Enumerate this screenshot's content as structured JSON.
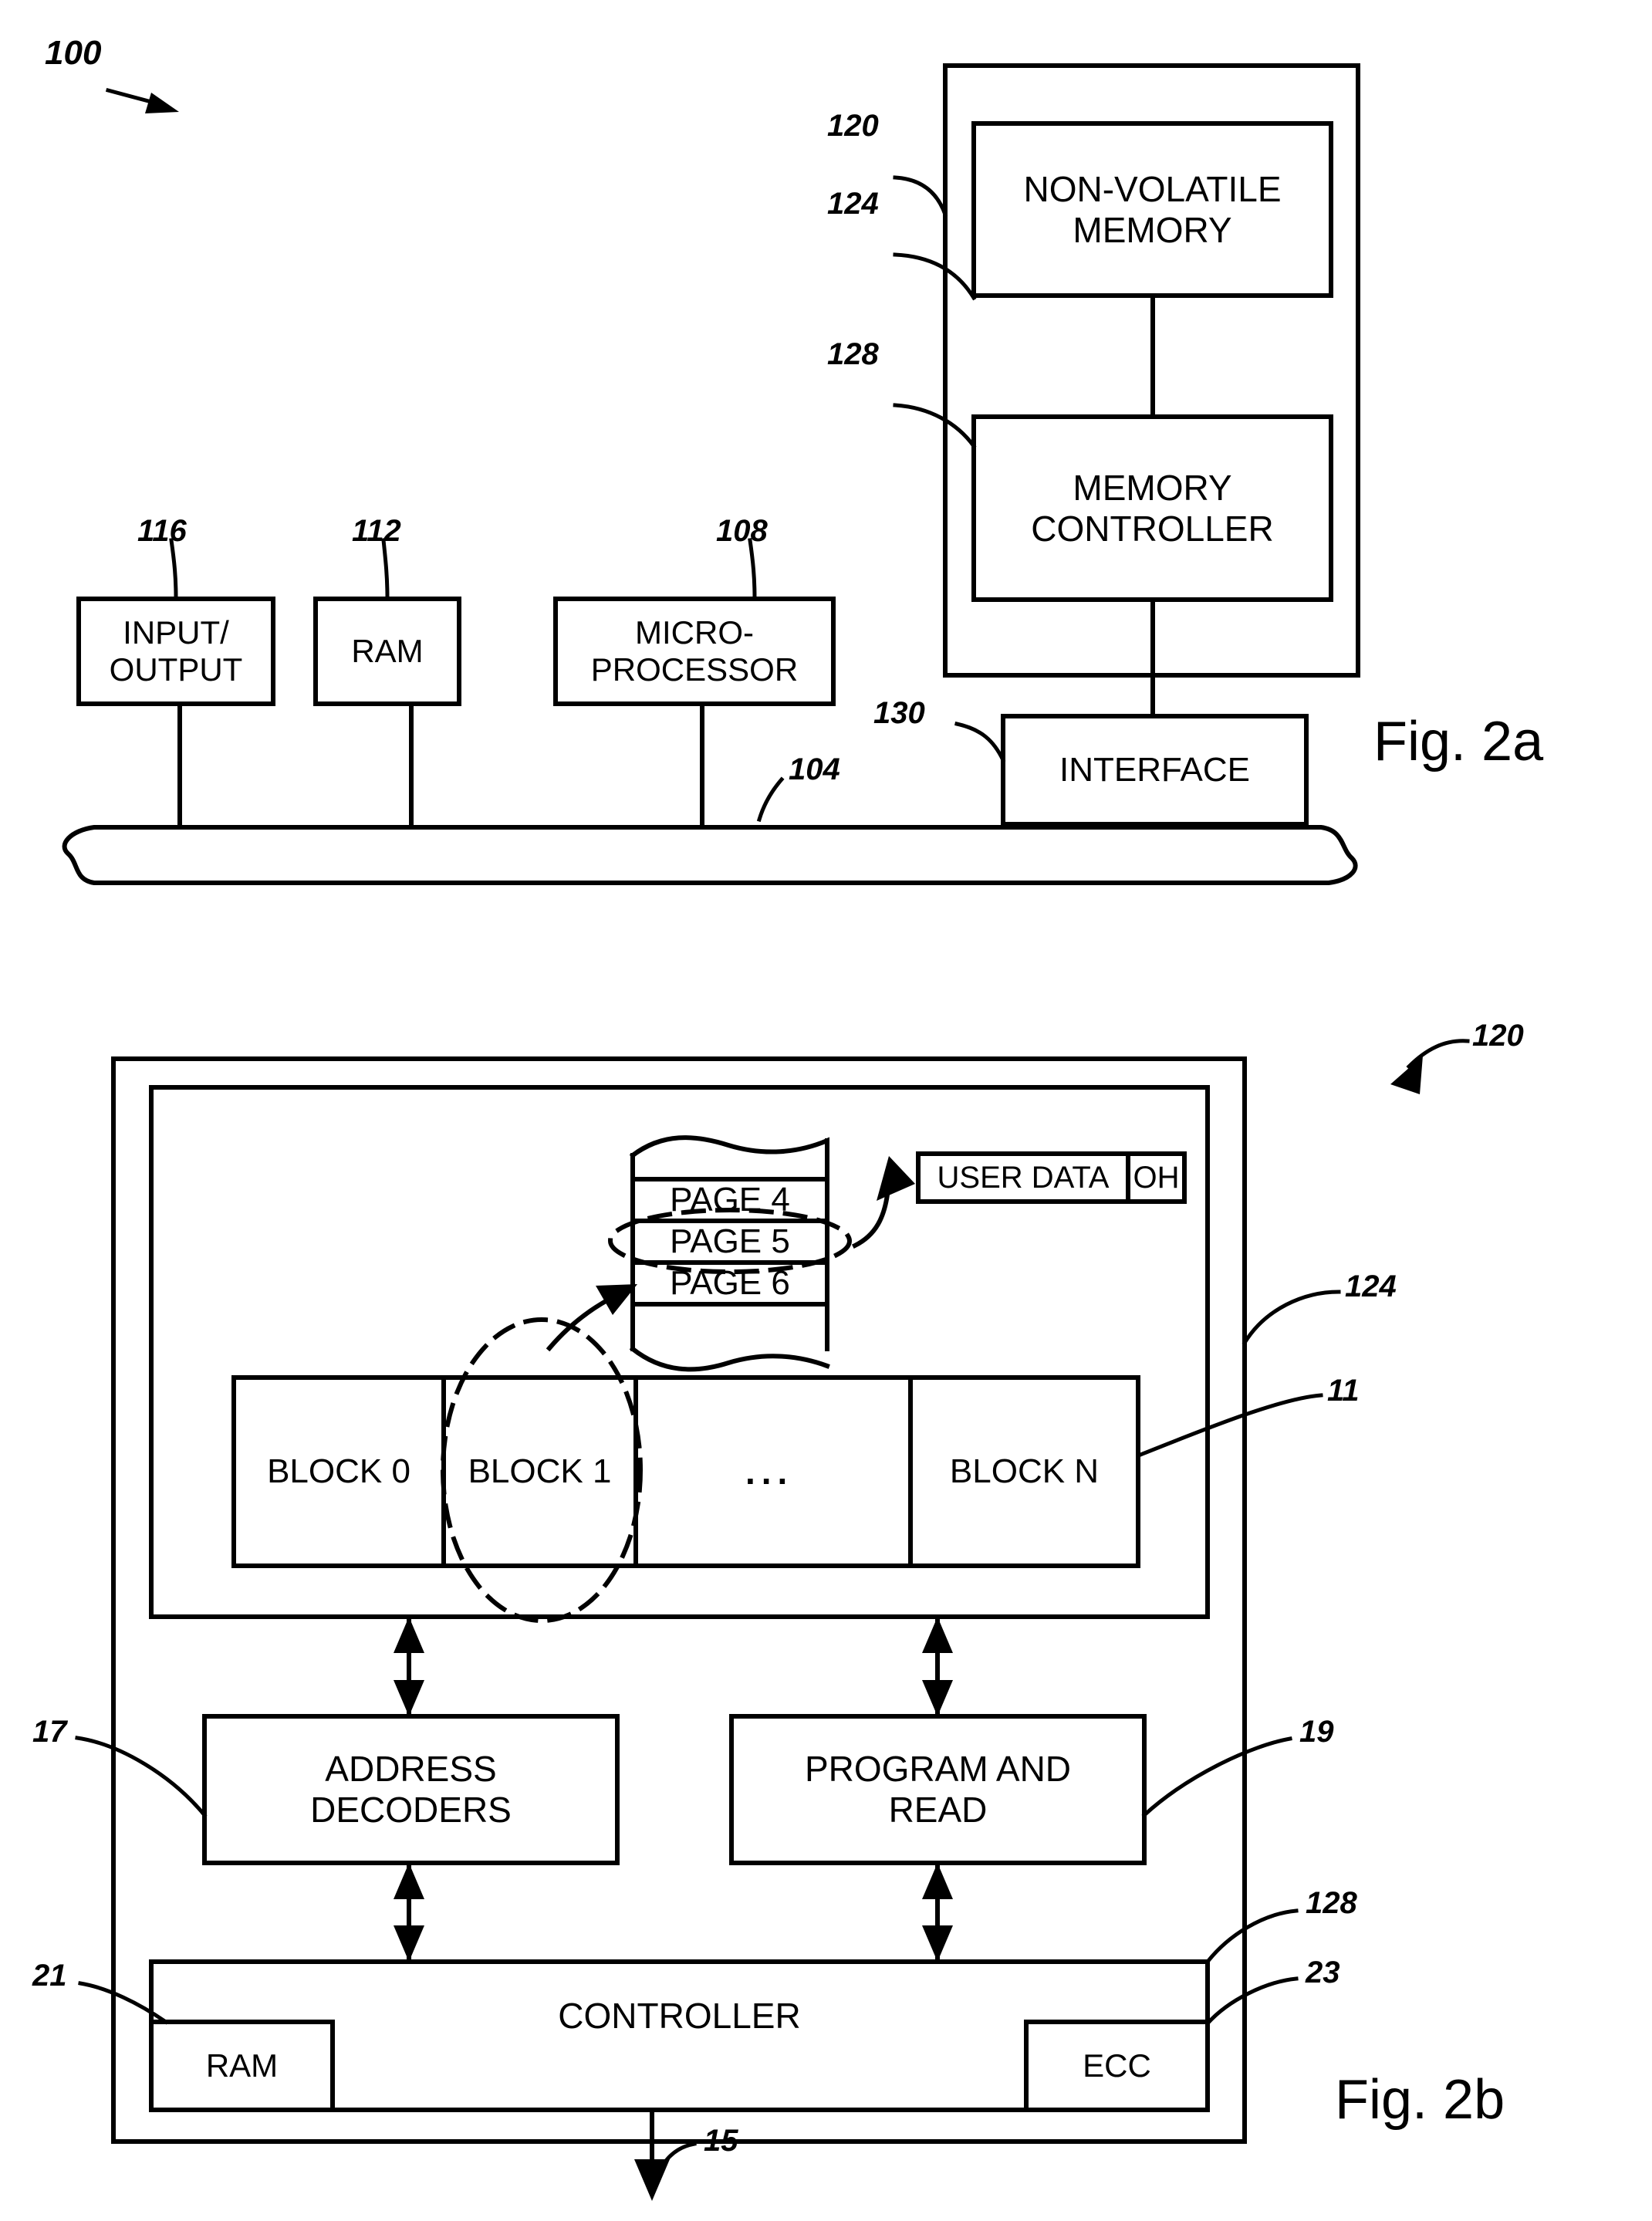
{
  "figure_a": {
    "caption": "Fig. 2a",
    "system_ref": "100",
    "bus_ref": "104",
    "card_ref": "120",
    "blocks": [
      {
        "ref": "116",
        "label": "INPUT/\nOUTPUT"
      },
      {
        "ref": "112",
        "label": "RAM"
      },
      {
        "ref": "108",
        "label": "MICRO-\nPROCESSOR"
      },
      {
        "ref": "124",
        "label": "NON-VOLATILE\nMEMORY"
      },
      {
        "ref": "128",
        "label": "MEMORY\nCONTROLLER"
      },
      {
        "ref": "130",
        "label": "INTERFACE"
      }
    ]
  },
  "figure_b": {
    "caption": "Fig. 2b",
    "card_ref": "120",
    "array_ref": "124",
    "blocks_ref": "11",
    "address_decoders_ref": "17",
    "program_read_ref": "19",
    "controller_ref": "128",
    "ram_ref": "21",
    "ecc_ref": "23",
    "host_bus_ref": "15",
    "pages": [
      {
        "label": "PAGE 4"
      },
      {
        "label": "PAGE 5"
      },
      {
        "label": "PAGE 6"
      }
    ],
    "page_fields": [
      {
        "label": "USER  DATA"
      },
      {
        "label": "OH"
      }
    ],
    "memory_blocks": [
      {
        "label": "BLOCK 0"
      },
      {
        "label": "BLOCK 1"
      },
      {
        "label": "..."
      },
      {
        "label": "BLOCK N"
      }
    ],
    "units": [
      {
        "label": "ADDRESS\nDECODERS"
      },
      {
        "label": "PROGRAM AND\nREAD"
      }
    ],
    "controller_label": "CONTROLLER",
    "controller_ram_label": "RAM",
    "controller_ecc_label": "ECC"
  },
  "colors": {
    "ink": "#000000",
    "paper": "#ffffff"
  }
}
